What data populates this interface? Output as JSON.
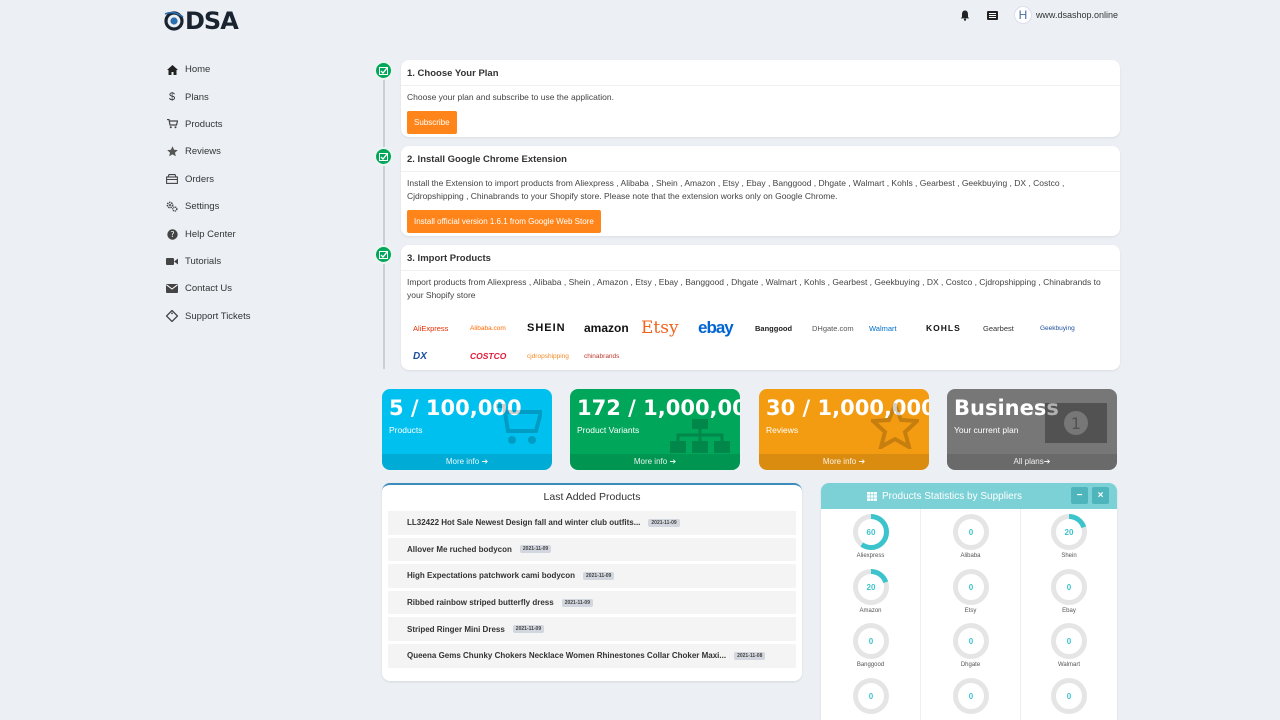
{
  "header": {
    "logo_text": "DSA",
    "site": "www.dsashop.online",
    "avatar_letter": "H"
  },
  "sidebar": {
    "items": [
      {
        "label": "Home",
        "icon": "home-icon"
      },
      {
        "label": "Plans",
        "icon": "dollar-icon"
      },
      {
        "label": "Products",
        "icon": "cart-icon"
      },
      {
        "label": "Reviews",
        "icon": "star-icon"
      },
      {
        "label": "Orders",
        "icon": "orders-icon"
      },
      {
        "label": "Settings",
        "icon": "gears-icon"
      },
      {
        "label": "Help Center",
        "icon": "question-icon"
      },
      {
        "label": "Tutorials",
        "icon": "video-icon"
      },
      {
        "label": "Contact Us",
        "icon": "envelope-icon"
      },
      {
        "label": "Support Tickets",
        "icon": "ticket-icon"
      }
    ]
  },
  "steps": {
    "plan": {
      "title": "1. Choose Your Plan",
      "text": "Choose your plan and subscribe to use the application.",
      "button": "Subscribe"
    },
    "extension": {
      "title": "2. Install Google Chrome Extension",
      "text": "Install the Extension to import products from Aliexpress , Alibaba , Shein , Amazon , Etsy , Ebay , Banggood , Dhgate , Walmart , Kohls , Gearbest , Geekbuying , DX , Costco , Cjdropshipping , Chinabrands to your Shopify store. Please note that the extension works only on Google Chrome.",
      "button": "Install official version 1.6.1 from Google Web Store"
    },
    "import": {
      "title": "3. Import Products",
      "text": "Import products from Aliexpress , Alibaba , Shein , Amazon , Etsy , Ebay , Banggood , Dhgate , Walmart , Kohls , Gearbest , Geekbuying , DX , Costco , Cjdropshipping , Chinabrands to your Shopify store",
      "brands": [
        {
          "name": "AliExpress",
          "color": "#e62e04"
        },
        {
          "name": "Alibaba.com",
          "color": "#ff6a00"
        },
        {
          "name": "SHEIN",
          "color": "#111111"
        },
        {
          "name": "amazon",
          "color": "#111111"
        },
        {
          "name": "Etsy",
          "color": "#f1641e"
        },
        {
          "name": "ebay",
          "color": "#0064d2"
        },
        {
          "name": "Banggood",
          "color": "#222222"
        },
        {
          "name": "DHgate.com",
          "color": "#555555"
        },
        {
          "name": "Walmart",
          "color": "#0071ce"
        },
        {
          "name": "KOHLS",
          "color": "#111111"
        },
        {
          "name": "Gearbest",
          "color": "#333333"
        },
        {
          "name": "Geekbuying",
          "color": "#1f4e9e"
        },
        {
          "name": "DX",
          "color": "#1a4d9c"
        },
        {
          "name": "COSTCO",
          "color": "#e31837"
        },
        {
          "name": "cjdropshipping",
          "color": "#f08a24"
        },
        {
          "name": "chinabrands",
          "color": "#c0392b"
        }
      ]
    }
  },
  "boxes": [
    {
      "value": "5 / 100,000",
      "label": "Products",
      "footer": "More info",
      "color": "#00c0ef",
      "icon": "cart-icon"
    },
    {
      "value": "172 / 1,000,000",
      "label": "Product Variants",
      "footer": "More info",
      "color": "#00a65a",
      "icon": "sitemap-icon"
    },
    {
      "value": "30 / 1,000,000",
      "label": "Reviews",
      "footer": "More info",
      "color": "#f39c12",
      "icon": "star-icon"
    },
    {
      "value": "Business",
      "label": "Your current plan",
      "footer": "All plans",
      "color": "#777777",
      "icon": "money-icon"
    }
  ],
  "last_products": {
    "title": "Last Added Products",
    "items": [
      {
        "name": "LL32422 Hot Sale Newest Design fall and winter club outfits...",
        "date": "2021-11-09"
      },
      {
        "name": "Allover Me ruched bodycon",
        "date": "2021-11-09"
      },
      {
        "name": "High Expectations patchwork cami bodycon",
        "date": "2021-11-09"
      },
      {
        "name": "Ribbed rainbow striped butterfly dress",
        "date": "2021-11-09"
      },
      {
        "name": "Striped Ringer Mini Dress",
        "date": "2021-11-09"
      },
      {
        "name": "Queena Gems Chunky Chokers Necklace Women Rhinestones Collar Choker Maxi...",
        "date": "2021-11-08"
      }
    ]
  },
  "stats": {
    "title": "Products Statistics by Suppliers",
    "minimize": "−",
    "close": "×",
    "accent": "#3bc4cc",
    "suppliers": [
      {
        "name": "Aliexpress",
        "value": 60
      },
      {
        "name": "Alibaba",
        "value": 0
      },
      {
        "name": "Shein",
        "value": 20
      },
      {
        "name": "Amazon",
        "value": 20
      },
      {
        "name": "Etsy",
        "value": 0
      },
      {
        "name": "Ebay",
        "value": 0
      },
      {
        "name": "Banggood",
        "value": 0
      },
      {
        "name": "Dhgate",
        "value": 0
      },
      {
        "name": "Walmart",
        "value": 0
      },
      {
        "name": "",
        "value": 0
      },
      {
        "name": "",
        "value": 0
      },
      {
        "name": "",
        "value": 0
      }
    ]
  }
}
